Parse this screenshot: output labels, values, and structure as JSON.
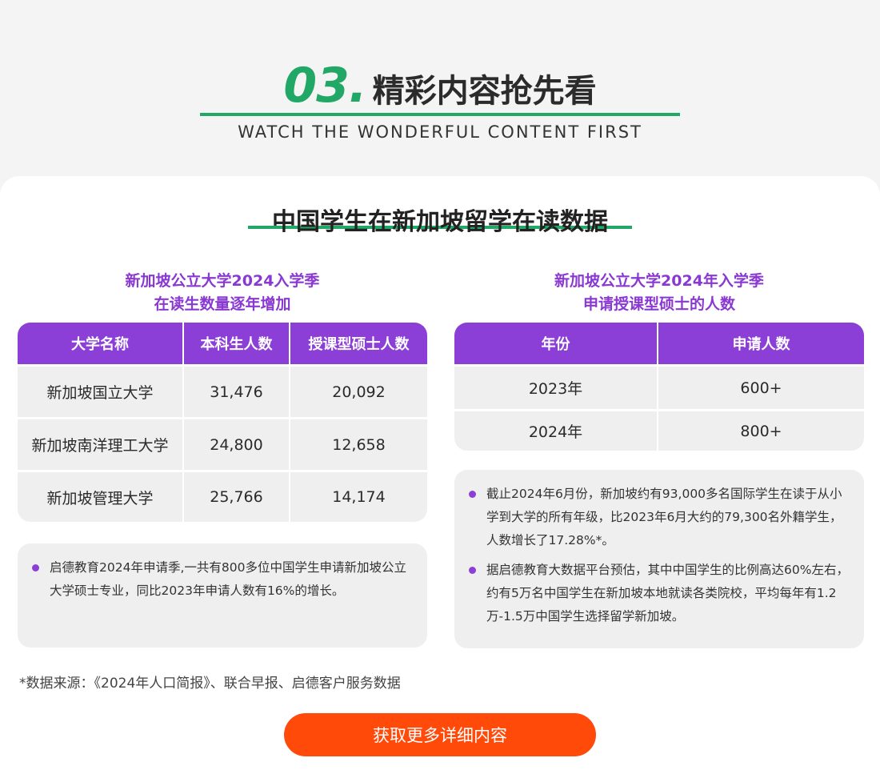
{
  "header": {
    "number": "03.",
    "title": "精彩内容抢先看",
    "subtitle": "WATCH THE WONDERFUL CONTENT FIRST"
  },
  "card": {
    "title": "中国学生在新加坡留学在读数据"
  },
  "left": {
    "title_line1": "新加坡公立大学2024入学季",
    "title_line2": "在读生数量逐年增加",
    "columns": [
      "大学名称",
      "本科生人数",
      "授课型硕士人数"
    ],
    "rows": [
      [
        "新加坡国立大学",
        "31,476",
        "20,092"
      ],
      [
        "新加坡南洋理工大学",
        "24,800",
        "12,658"
      ],
      [
        "新加坡管理大学",
        "25,766",
        "14,174"
      ]
    ],
    "note": "启德教育2024年申请季,一共有800多位中国学生申请新加坡公立大学硕士专业，同比2023年申请人数有16%的增长。"
  },
  "right": {
    "title_line1": "新加坡公立大学2024年入学季",
    "title_line2": "申请授课型硕士的人数",
    "columns": [
      "年份",
      "申请人数"
    ],
    "rows": [
      [
        "2023年",
        "600+"
      ],
      [
        "2024年",
        "800+"
      ]
    ],
    "notes": [
      "截止2024年6月份，新加坡约有93,000多名国际学生在读于从小学到大学的所有年级，比2023年6月大约的79,300名外籍学生，人数增长了17.28%*。",
      "据启德教育大数据平台预估，其中中国学生的比例高达60%左右，约有5万名中国学生在新加坡本地就读各类院校，平均每年有1.2万-1.5万中国学生选择留学新加坡。"
    ]
  },
  "source": "*数据来源：《2024年人口简报》、联合早报、启德客户服务数据",
  "cta": "获取更多详细内容",
  "colors": {
    "green": "#22a866",
    "purple": "#8c3fd6",
    "orange": "#ff4a0a"
  }
}
